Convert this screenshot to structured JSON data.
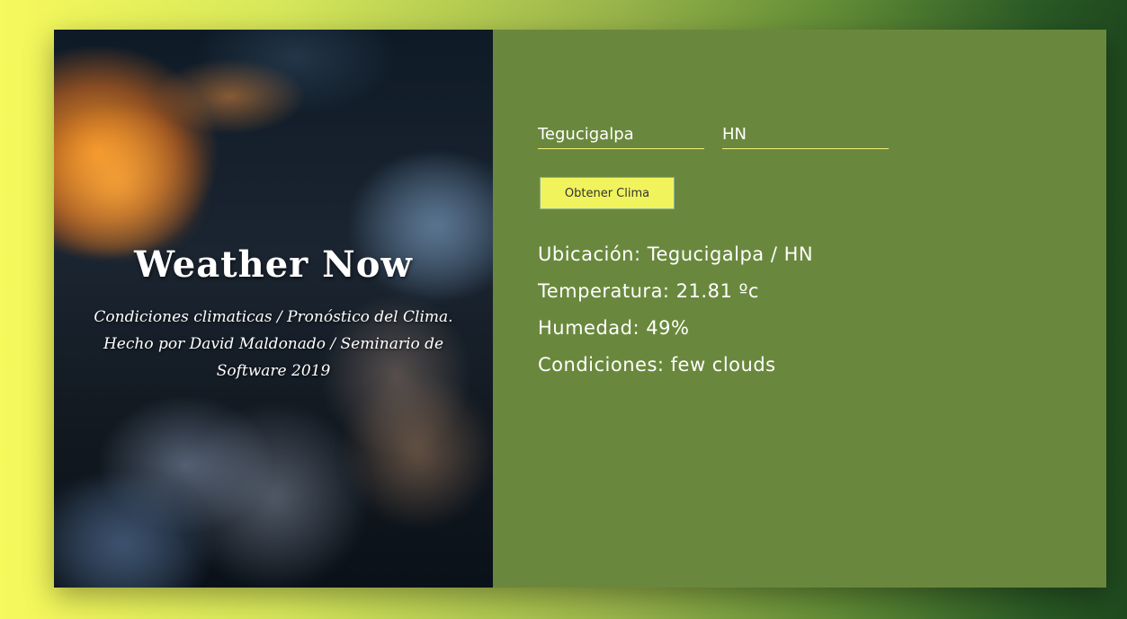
{
  "hero": {
    "title": "Weather Now",
    "subtitle_line1": "Condiciones climaticas / Pronóstico del Clima.",
    "subtitle_line2": "Hecho por David Maldonado / Seminario de",
    "subtitle_line3": "Software 2019"
  },
  "form": {
    "city_value": "Tegucigalpa",
    "country_value": "HN",
    "submit_label": "Obtener Clima"
  },
  "results": {
    "location": "Ubicación: Tegucigalpa / HN",
    "temperature": "Temperatura: 21.81 ºc",
    "humidity": "Humedad: 49%",
    "conditions": "Condiciones: few clouds"
  },
  "colors": {
    "panel_bg": "#6a883d",
    "button_bg": "#f1f35d",
    "input_underline": "#f3f07a"
  }
}
